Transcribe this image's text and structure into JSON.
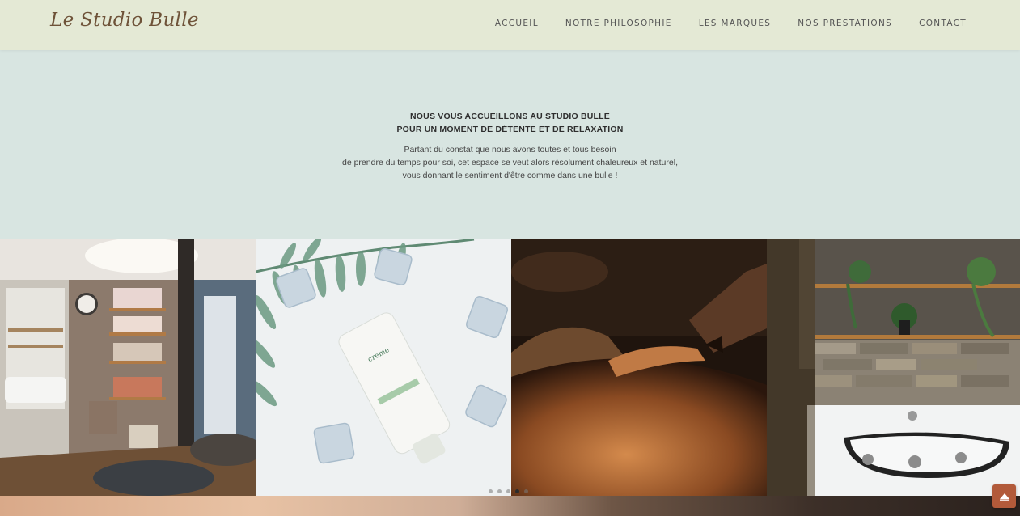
{
  "site": {
    "logo": "Le Studio Bulle"
  },
  "nav": {
    "items": [
      "ACCUEIL",
      "NOTRE PHILOSOPHIE",
      "LES MARQUES",
      "NOS PRESTATIONS",
      "CONTACT"
    ]
  },
  "intro": {
    "title_line1": "NOUS VOUS ACCUEILLONS AU STUDIO BULLE",
    "title_line2": "POUR UN MOMENT DE DÉTENTE ET DE RELAXATION",
    "text_line1": "Partant du constat que nous avons toutes et tous besoin",
    "text_line2": "de prendre du temps pour soi, cet espace se veut alors résolument chaleureux et naturel,",
    "text_line3": "vous donnant le sentiment d'être comme dans une bulle !"
  },
  "gallery": {
    "images": [
      "salon-interior",
      "cream-tube-with-ice",
      "massage-back",
      "spa-bathtub"
    ],
    "slider": {
      "count": 5,
      "active_index": 3
    }
  },
  "colors": {
    "header_bg": "#e4e9d5",
    "intro_bg": "#d8e5e1",
    "logo": "#6e5238",
    "back_to_top": "#b25a3a"
  },
  "icons": {
    "back_to_top": "arrow-up-icon"
  }
}
